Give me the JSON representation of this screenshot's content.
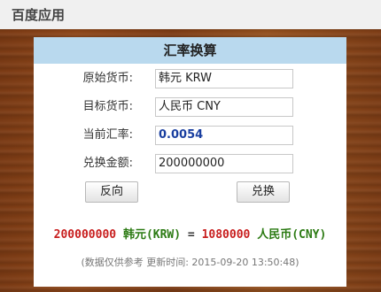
{
  "app": {
    "title": "百度应用"
  },
  "panel": {
    "title": "汇率换算"
  },
  "form": {
    "source_label": "原始货币:",
    "source_value": "韩元 KRW",
    "target_label": "目标货币:",
    "target_value": "人民币 CNY",
    "rate_label": "当前汇率:",
    "rate_value": "0.0054",
    "amount_label": "兑换金额:",
    "amount_value": "200000000"
  },
  "buttons": {
    "reverse": "反向",
    "convert": "兑换"
  },
  "result": {
    "from_amount": "200000000",
    "from_currency": "韩元(KRW)",
    "equals": "=",
    "to_amount": "1080000",
    "to_currency": "人民币(CNY)"
  },
  "note": "(数据仅供参考 更新时间: 2015-09-20 13:50:48)",
  "colors": {
    "header_bg": "#b9d9ee",
    "amount_red": "#c81e1e",
    "currency_green": "#2b7a12",
    "rate_blue": "#1a3fa0"
  }
}
